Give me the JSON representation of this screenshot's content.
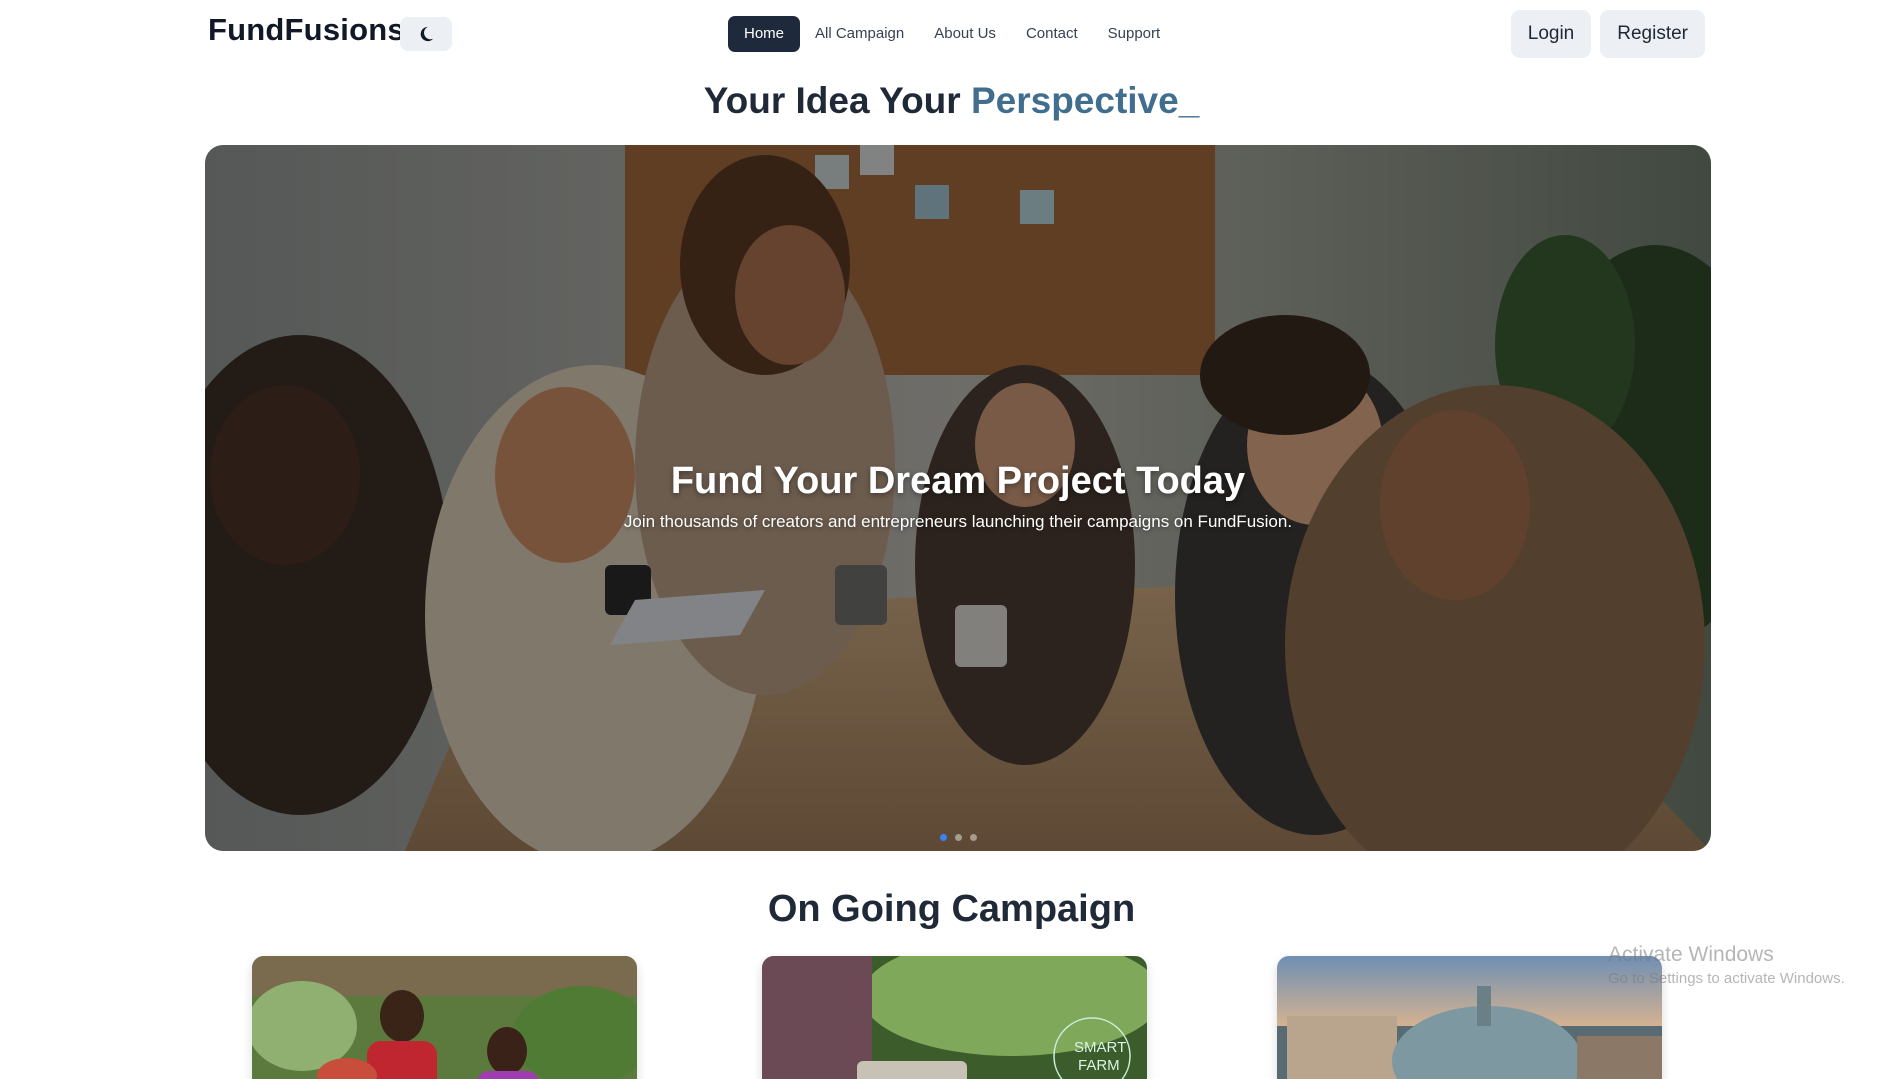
{
  "header": {
    "logo": "FundFusions",
    "theme_icon": "moon-icon",
    "nav": [
      {
        "label": "Home",
        "active": true
      },
      {
        "label": "All Campaign",
        "active": false
      },
      {
        "label": "About Us",
        "active": false
      },
      {
        "label": "Contact",
        "active": false
      },
      {
        "label": "Support",
        "active": false
      }
    ],
    "login_label": "Login",
    "register_label": "Register"
  },
  "tagline": {
    "prefix": "Your Idea Your",
    "highlight": "Perspective",
    "cursor": "_"
  },
  "hero": {
    "title": "Fund Your Dream Project Today",
    "subtitle": "Join thousands of creators and entrepreneurs launching their campaigns on FundFusion.",
    "slide_count": 3,
    "active_slide": 1
  },
  "campaigns": {
    "title": "On Going Campaign",
    "cards": [
      {
        "image": "community-garden-photo"
      },
      {
        "image": "smart-farm-photo",
        "image_text": [
          "SMART",
          "FARM"
        ]
      },
      {
        "image": "city-dome-photo"
      }
    ]
  },
  "watermark": {
    "title": "Activate Windows",
    "subtitle": "Go to Settings to activate Windows."
  },
  "colors": {
    "accent": "#416e8e",
    "nav_active_bg": "#1e2a3b",
    "button_bg": "#eceff3",
    "dot_active": "#3b82f6"
  }
}
